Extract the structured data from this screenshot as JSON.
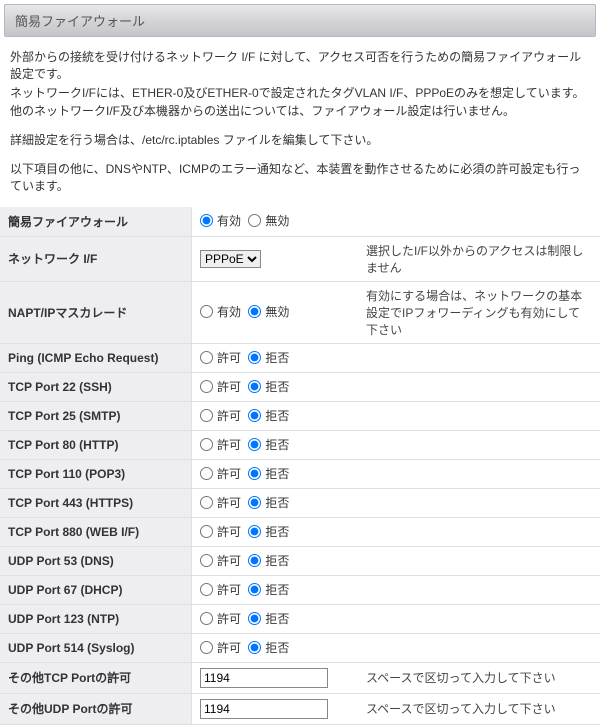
{
  "header": {
    "title": "簡易ファイアウォール"
  },
  "intro": {
    "p1": "外部からの接統を受け付けるネットワーク I/F に対して、アクセス可否を行うための簡易ファイアウォール設定です。",
    "p2": "ネットワークI/Fには、ETHER-0及びETHER-0で設定されたタグVLAN I/F、PPPoEのみを想定しています。",
    "p3": "他のネットワークI/F及び本機器からの送出については、ファイアウォール設定は行いません。",
    "p4": "詳細設定を行う場合は、/etc/rc.iptables ファイルを編集して下さい。",
    "p5": "以下項目の他に、DNSやNTP、ICMPのエラー通知など、本装置を動作させるために必須の許可設定も行っています。"
  },
  "labels": {
    "enable": "有効",
    "disable": "無効",
    "allow": "許可",
    "deny": "拒否"
  },
  "rows": {
    "firewall": {
      "label": "簡易ファイアウォール",
      "note": ""
    },
    "netif": {
      "label": "ネットワーク I/F",
      "selected": "PPPoE",
      "note": "選択したI/F以外からのアクセスは制限しません"
    },
    "napt": {
      "label": "NAPT/IPマスカレード",
      "note": "有効にする場合は、ネットワークの基本設定でIPフォワーディングも有効にして下さい"
    },
    "ping": {
      "label": "Ping (ICMP Echo Request)"
    },
    "tcp22": {
      "label": "TCP Port 22 (SSH)"
    },
    "tcp25": {
      "label": "TCP Port 25 (SMTP)"
    },
    "tcp80": {
      "label": "TCP Port 80 (HTTP)"
    },
    "tcp110": {
      "label": "TCP Port 110 (POP3)"
    },
    "tcp443": {
      "label": "TCP Port 443 (HTTPS)"
    },
    "tcp880": {
      "label": "TCP Port 880 (WEB I/F)"
    },
    "udp53": {
      "label": "UDP Port 53 (DNS)"
    },
    "udp67": {
      "label": "UDP Port 67 (DHCP)"
    },
    "udp123": {
      "label": "UDP Port 123 (NTP)"
    },
    "udp514": {
      "label": "UDP Port 514 (Syslog)"
    },
    "other_tcp": {
      "label": "その他TCP Portの許可",
      "value": "1194",
      "note": "スペースで区切って入力して下さい"
    },
    "other_udp": {
      "label": "その他UDP Portの許可",
      "value": "1194",
      "note": "スペースで区切って入力して下さい"
    }
  }
}
